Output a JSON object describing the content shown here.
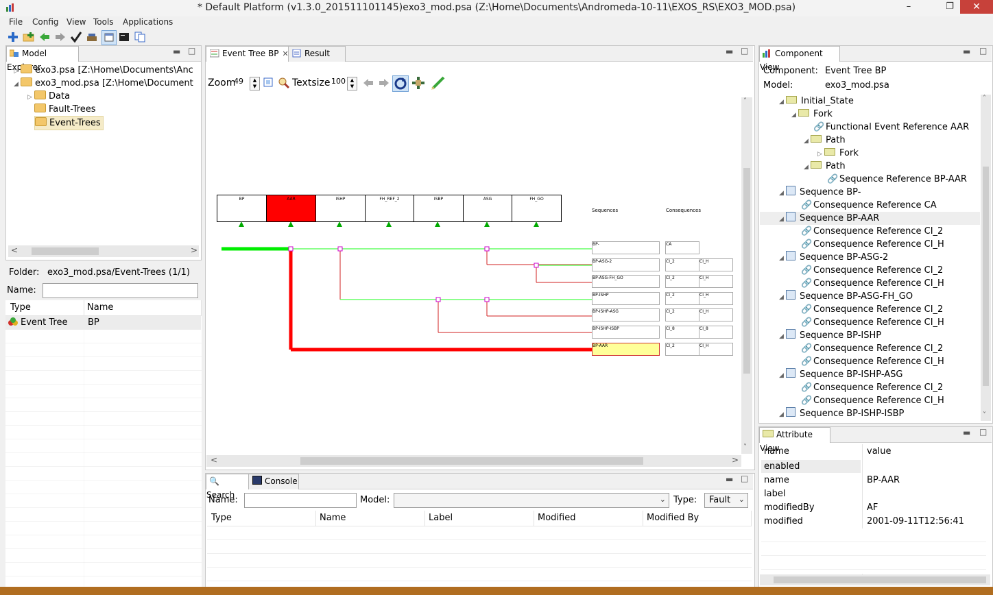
{
  "window": {
    "title": "* Default Platform (v1.3.0_201511101145)exo3_mod.psa (Z:\\Home\\Documents\\Andromeda-10-11\\EXOS_RS\\EXO3_MOD.psa)"
  },
  "menu": [
    "File",
    "Config",
    "View",
    "Tools",
    "Applications"
  ],
  "model_explorer": {
    "tab": "Model Explorer",
    "tree": [
      {
        "label": "exo3.psa [Z:\\Home\\Documents\\Anc"
      },
      {
        "label": "exo3_mod.psa [Z:\\Home\\Document"
      },
      {
        "label": "Data"
      },
      {
        "label": "Fault-Trees"
      },
      {
        "label": "Event-Trees"
      }
    ],
    "folder_label": "Folder:",
    "folder_value": "exo3_mod.psa/Event-Trees (1/1)",
    "name_label": "Name:",
    "columns": [
      "Type",
      "Name"
    ],
    "rows": [
      {
        "type": "Event Tree",
        "name": "BP"
      }
    ]
  },
  "editor": {
    "tabs": [
      "Event Tree BP",
      "Result"
    ],
    "zoom_label": "Zoom",
    "zoom_value": "49",
    "textsize_label": "Textsize",
    "textsize_value": "100",
    "headers": [
      "BP",
      "AAR",
      "ISHP",
      "FH_REF_2",
      "ISBP",
      "ASG",
      "FH_GO"
    ],
    "sequences_label": "Sequences",
    "consequences_label": "Consequences",
    "sequences": [
      "BP-",
      "BP-ASG-2",
      "BP-ASG-FH_GO",
      "BP-ISHP",
      "BP-ISHP-ASG",
      "BP-ISHP-ISBP",
      "BP-AAR"
    ],
    "consequences": [
      [
        "CA"
      ],
      [
        "CI_2",
        "CI_H"
      ],
      [
        "CI_2",
        "CI_H"
      ],
      [
        "CI_2",
        "CI_H"
      ],
      [
        "CI_2",
        "CI_H"
      ],
      [
        "CI_8",
        "CI_8"
      ],
      [
        "CI_2",
        "CI_H"
      ]
    ]
  },
  "component_view": {
    "tab": "Component View",
    "component_label": "Component:",
    "component_value": "Event Tree BP",
    "model_label": "Model:",
    "model_value": "exo3_mod.psa",
    "rows": [
      "Initial_State",
      "Fork",
      "Functional Event Reference AAR",
      "Path",
      "Fork",
      "Path",
      "Sequence Reference BP-AAR",
      "Sequence BP-",
      "Consequence Reference CA",
      "Sequence BP-AAR",
      "Consequence Reference CI_2",
      "Consequence Reference CI_H",
      "Sequence BP-ASG-2",
      "Consequence Reference CI_2",
      "Consequence Reference CI_H",
      "Sequence BP-ASG-FH_GO",
      "Consequence Reference CI_2",
      "Consequence Reference CI_H",
      "Sequence BP-ISHP",
      "Consequence Reference CI_2",
      "Consequence Reference CI_H",
      "Sequence BP-ISHP-ASG",
      "Consequence Reference CI_2",
      "Consequence Reference CI_H",
      "Sequence BP-ISHP-ISBP"
    ]
  },
  "attribute_view": {
    "tab": "Attribute View",
    "columns": [
      "name",
      "value"
    ],
    "rows": [
      {
        "name": "enabled",
        "value": ""
      },
      {
        "name": "name",
        "value": "BP-AAR"
      },
      {
        "name": "label",
        "value": ""
      },
      {
        "name": "modifiedBy",
        "value": "AF"
      },
      {
        "name": "modified",
        "value": "2001-09-11T12:56:41"
      }
    ]
  },
  "search": {
    "tabs": [
      "Search",
      "Console"
    ],
    "name_label": "Name:",
    "model_label": "Model:",
    "type_label": "Type:",
    "type_value": "Fault",
    "columns": [
      "Type",
      "Name",
      "Label",
      "Modified",
      "Modified By"
    ]
  },
  "colors": {
    "failure": "#ff0000",
    "success": "#00ee00",
    "selected_seq": "#ffff99"
  }
}
